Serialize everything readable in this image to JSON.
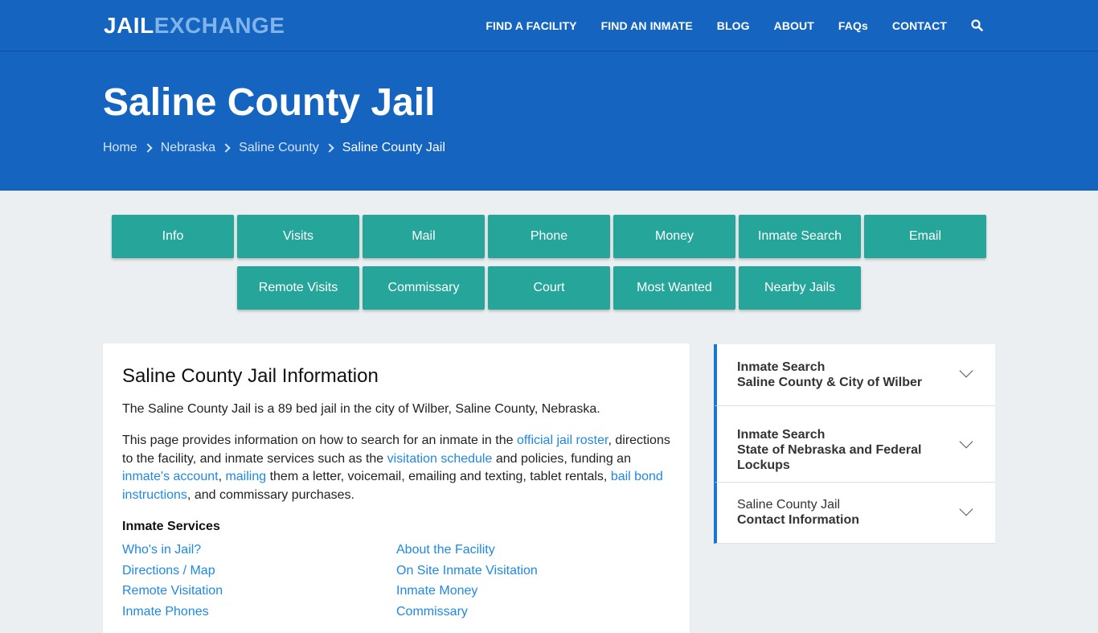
{
  "brand": {
    "part1": "JAIL",
    "part2": "EXCHANGE"
  },
  "nav": {
    "items": [
      "FIND A FACILITY",
      "FIND AN INMATE",
      "BLOG",
      "ABOUT",
      "FAQs",
      "CONTACT"
    ],
    "search_icon": "search-icon"
  },
  "hero": {
    "title": "Saline County Jail",
    "breadcrumb": [
      "Home",
      "Nebraska",
      "Saline County",
      "Saline County Jail"
    ]
  },
  "tabs": {
    "row1": [
      "Info",
      "Visits",
      "Mail",
      "Phone",
      "Money",
      "Inmate Search",
      "Email"
    ],
    "row2": [
      "Remote Visits",
      "Commissary",
      "Court",
      "Most Wanted",
      "Nearby Jails"
    ]
  },
  "main": {
    "heading": "Saline County Jail Information",
    "intro": "The Saline County Jail is a 89 bed jail in the city of Wilber, Saline County, Nebraska.",
    "para": {
      "t1": "This page provides information on how to search for an inmate in the ",
      "l1": "official jail roster",
      "t2": ", directions to the facility, and inmate services such as the ",
      "l2": "visitation schedule",
      "t3": " and policies, funding an ",
      "l3": "inmate's account",
      "t4": ", ",
      "l4": "mailing",
      "t5": " them a letter, voicemail, emailing and texting, tablet rentals, ",
      "l5": "bail bond instructions",
      "t6": ", and commissary purchases."
    },
    "services_title": "Inmate Services",
    "services_col1": [
      "Who's in Jail?",
      "Directions / Map",
      "Remote Visitation",
      "Inmate Phones"
    ],
    "services_col2": [
      "About the Facility",
      "On Site Inmate Visitation",
      "Inmate Money",
      "Commissary"
    ]
  },
  "sidebar": {
    "accordions": [
      {
        "line1": "Inmate Search",
        "line2": "Saline County & City of Wilber"
      },
      {
        "line1": "Inmate Search",
        "line2": "State of Nebraska and Federal Lockups"
      },
      {
        "line1": "Saline County Jail",
        "line2": "Contact Information"
      }
    ]
  },
  "colors": {
    "primary_blue": "#1565c0",
    "teal_button": "#26a69a",
    "link_blue": "#1e88e5",
    "background": "#eceff1"
  }
}
